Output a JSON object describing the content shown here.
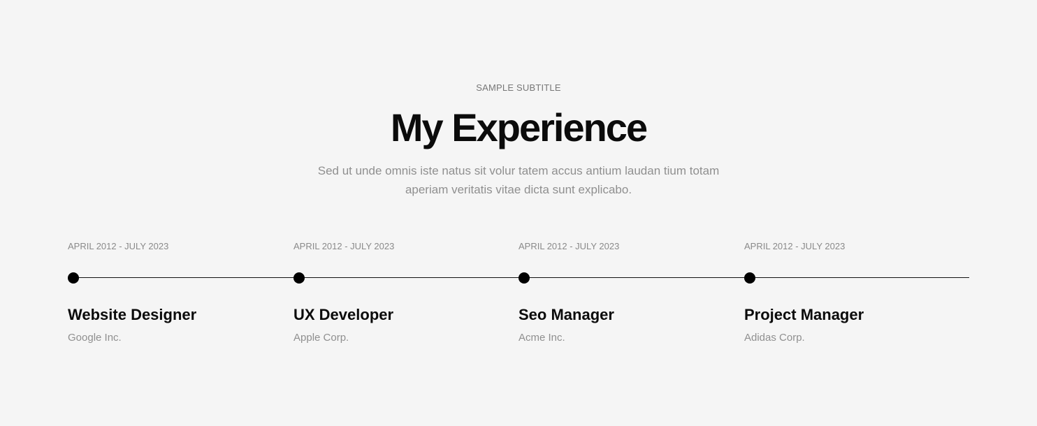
{
  "header": {
    "subtitle": "SAMPLE SUBTITLE",
    "title": "My Experience",
    "description": "Sed ut unde omnis iste natus sit volur tatem accus antium laudan tium totam aperiam veritatis vitae dicta sunt explicabo."
  },
  "experience": [
    {
      "date": "APRIL 2012 - JULY 2023",
      "role": "Website Designer",
      "company": "Google Inc."
    },
    {
      "date": "APRIL 2012 - JULY 2023",
      "role": "UX Developer",
      "company": "Apple Corp."
    },
    {
      "date": "APRIL 2012 - JULY 2023",
      "role": "Seo Manager",
      "company": "Acme Inc."
    },
    {
      "date": "APRIL 2012 - JULY 2023",
      "role": "Project Manager",
      "company": "Adidas Corp."
    }
  ],
  "colors": {
    "background": "#f5f5f5",
    "text_primary": "#0b0b0b",
    "text_muted": "#8f8f8f",
    "timeline": "#111111"
  }
}
